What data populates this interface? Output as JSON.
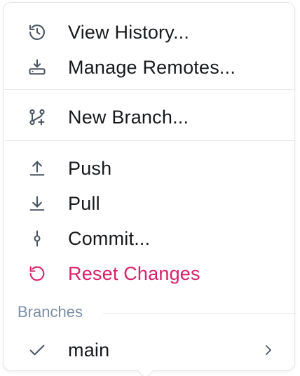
{
  "menu": {
    "items": [
      {
        "label": "View History...",
        "icon": "history-icon"
      },
      {
        "label": "Manage Remotes...",
        "icon": "remotes-icon"
      },
      {
        "label": "New Branch...",
        "icon": "branch-add-icon"
      },
      {
        "label": "Push",
        "icon": "push-arrow-up-icon"
      },
      {
        "label": "Pull",
        "icon": "pull-arrow-down-icon"
      },
      {
        "label": "Commit...",
        "icon": "commit-icon"
      },
      {
        "label": "Reset Changes",
        "icon": "reset-icon"
      }
    ],
    "branches_section": {
      "title": "Branches",
      "items": [
        {
          "label": "main",
          "checked": true,
          "has_submenu": true
        }
      ]
    }
  },
  "colors": {
    "text": "#17191c",
    "icon": "#4b5563",
    "danger": "#d6216b",
    "section_title": "#7a8fa6",
    "border": "#e3e5e8"
  }
}
